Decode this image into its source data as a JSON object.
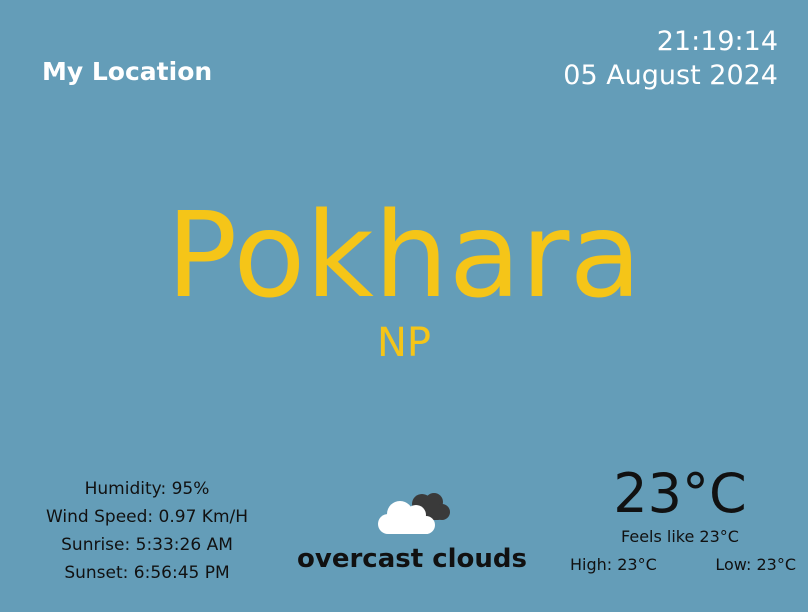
{
  "header": {
    "location_label": "My Location",
    "time": "21:19:14",
    "date": "05 August 2024"
  },
  "city": {
    "name": "Pokhara",
    "country": "NP"
  },
  "details": {
    "humidity": "Humidity: 95%",
    "wind_speed": "Wind Speed: 0.97 Km/H",
    "sunrise": "Sunrise: 5:33:26 AM",
    "sunset": "Sunset: 6:56:45 PM"
  },
  "condition": {
    "icon": "overcast-clouds-icon",
    "text": "overcast clouds"
  },
  "temperature": {
    "current": "23°C",
    "feels_like": "Feels like 23°C",
    "high": "High: 23°C",
    "low": "Low: 23°C"
  },
  "colors": {
    "background": "#649db8",
    "accent": "#f5c518",
    "header_text": "#ffffff"
  }
}
